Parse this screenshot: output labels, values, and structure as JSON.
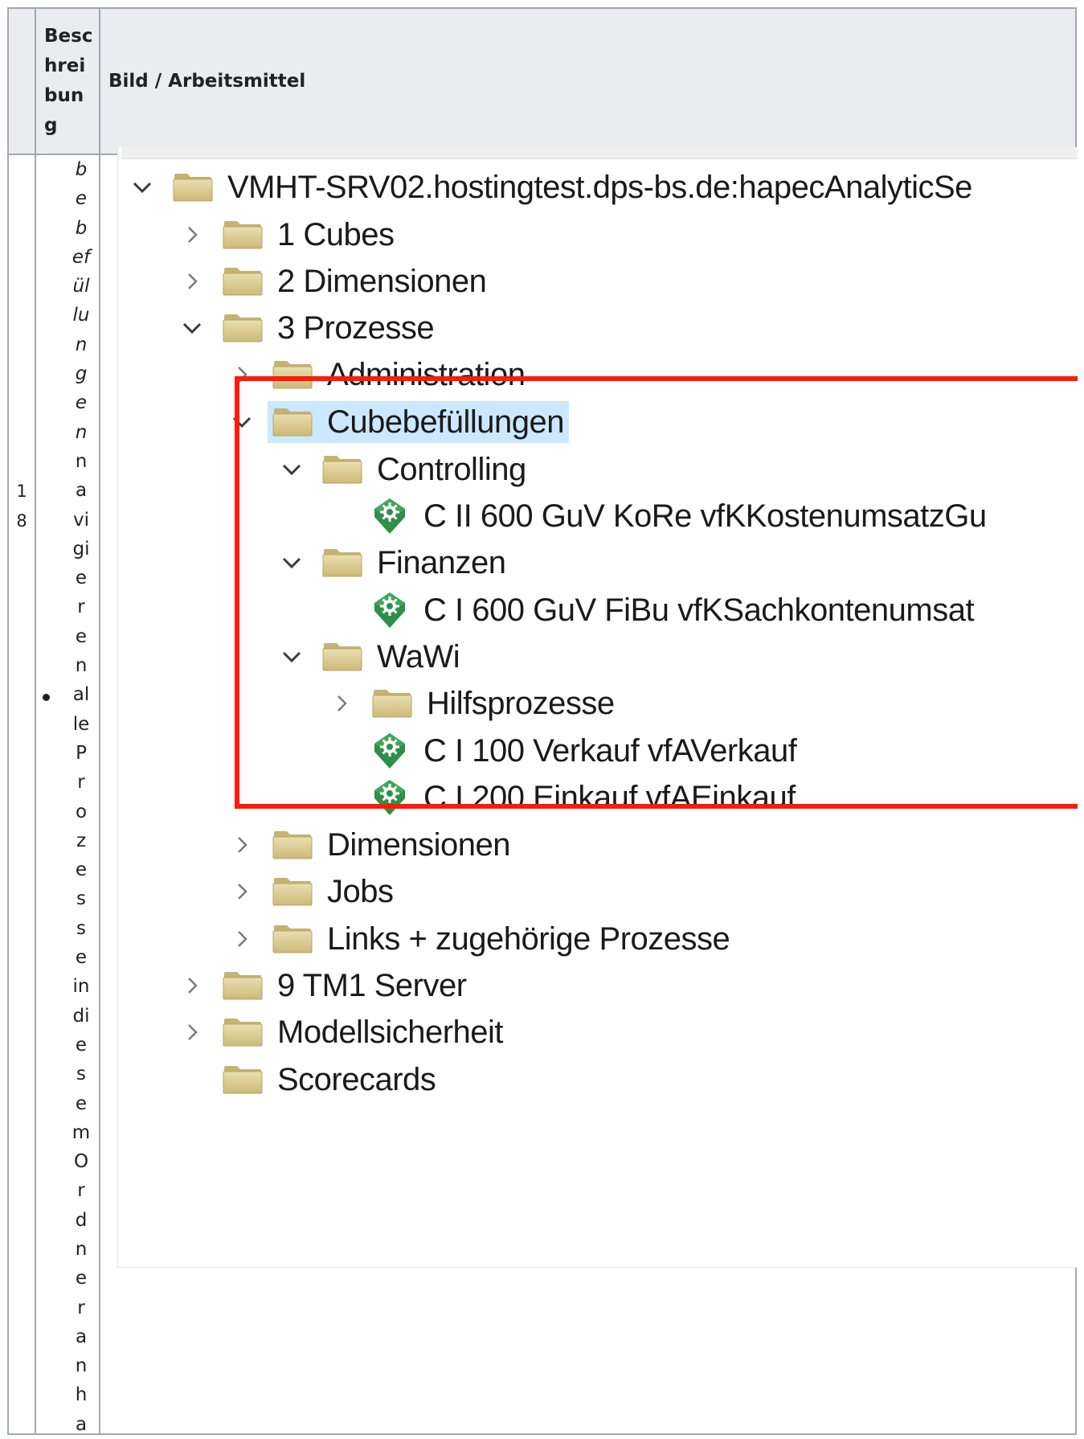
{
  "table": {
    "headers": {
      "number": "",
      "description_lines": [
        "Besc",
        "hrei",
        "bun",
        "g"
      ],
      "image": "Bild / Arbeitsmittel"
    },
    "row": {
      "number_lines": [
        "1",
        "8"
      ],
      "desc_italic_lines": [
        "b",
        "e",
        "b",
        "ef",
        "ül",
        "lu",
        "n",
        "g",
        "e",
        "n"
      ],
      "desc_lines": [
        "n",
        "a",
        "vi",
        "gi",
        "e",
        "r",
        "e",
        "n",
        "al",
        "le",
        "P",
        "r",
        "o",
        "z",
        "e",
        "s",
        "s",
        "e",
        "in",
        "di",
        "e",
        "s",
        "e",
        "m",
        "O",
        "r",
        "d",
        "n",
        "e",
        "r",
        "a",
        "n",
        "h",
        "a"
      ]
    }
  },
  "tree": {
    "root": "VMHT-SRV02.hostingtest.dps-bs.de:hapecAnalyticSe",
    "cubes": "1 Cubes",
    "dimensionen": "2 Dimensionen",
    "prozesse": "3 Prozesse",
    "administration": "Administration",
    "cubebefuellungen": "Cubebefüllungen",
    "controlling": "Controlling",
    "controlling_proc": "C II 600 GuV KoRe vfKKostenumsatzGu",
    "finanzen": "Finanzen",
    "finanzen_proc": "C I 600 GuV FiBu vfKSachkontenumsat",
    "wawi": "WaWi",
    "hilfsprozesse": "Hilfsprozesse",
    "verkauf": "C I 100 Verkauf vfAVerkauf",
    "einkauf": "C I 200 Einkauf vfAEinkauf",
    "dim_sub": "Dimensionen",
    "jobs": "Jobs",
    "links": "Links + zugehörige Prozesse",
    "tm1": "9 TM1 Server",
    "modell": "Modellsicherheit",
    "scorecards": "Scorecards"
  },
  "colors": {
    "highlight": "#cce8ff",
    "redbox": "#ff1a0a",
    "folder": "#d9c98f",
    "process": "#2f8f4a"
  }
}
